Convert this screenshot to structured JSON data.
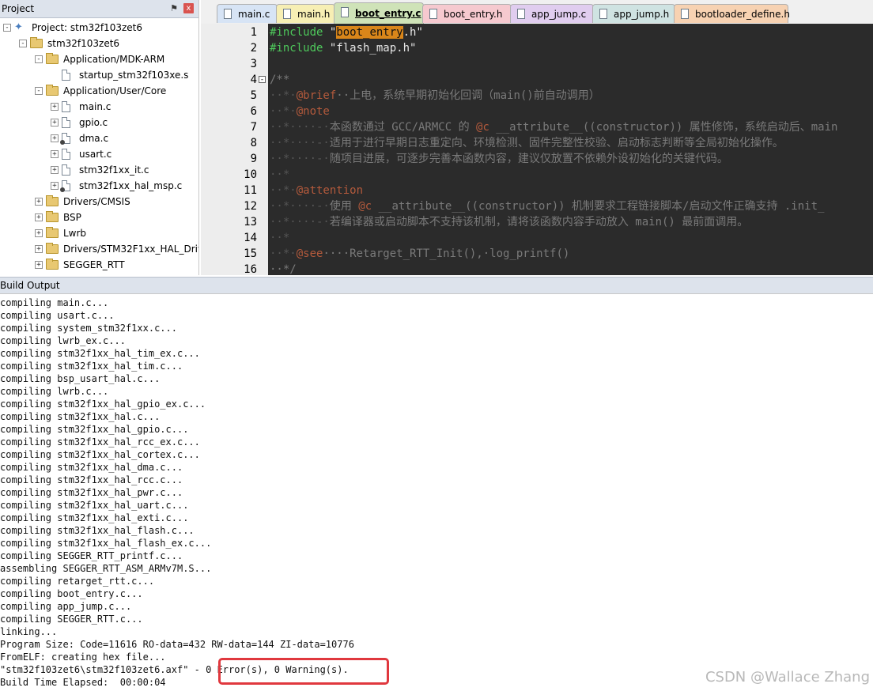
{
  "project": {
    "header_title": "Project",
    "pin_glyph": "⚑",
    "close_glyph": "x",
    "tree": [
      {
        "label": "Project: stm32f103zet6",
        "icon": "project-icon",
        "toggle": "-"
      },
      {
        "label": "stm32f103zet6",
        "icon": "target-folder-icon",
        "toggle": "-"
      },
      {
        "label": "Application/MDK-ARM",
        "icon": "folder-icon",
        "toggle": "-"
      },
      {
        "label": "startup_stm32f103xe.s",
        "icon": "file-icon",
        "toggle": ""
      },
      {
        "label": "Application/User/Core",
        "icon": "folder-icon",
        "toggle": "-"
      },
      {
        "label": "main.c",
        "icon": "file-icon",
        "toggle": "+"
      },
      {
        "label": "gpio.c",
        "icon": "file-icon",
        "toggle": "+"
      },
      {
        "label": "dma.c",
        "icon": "file-key-icon",
        "toggle": "+"
      },
      {
        "label": "usart.c",
        "icon": "file-icon",
        "toggle": "+"
      },
      {
        "label": "stm32f1xx_it.c",
        "icon": "file-icon",
        "toggle": "+"
      },
      {
        "label": "stm32f1xx_hal_msp.c",
        "icon": "file-key-icon",
        "toggle": "+"
      },
      {
        "label": "Drivers/CMSIS",
        "icon": "folder-icon",
        "toggle": "+"
      },
      {
        "label": "BSP",
        "icon": "folder-icon",
        "toggle": "+"
      },
      {
        "label": "Lwrb",
        "icon": "folder-icon",
        "toggle": "+"
      },
      {
        "label": "Drivers/STM32F1xx_HAL_Driver",
        "icon": "folder-icon",
        "toggle": "+"
      },
      {
        "label": "SEGGER_RTT",
        "icon": "folder-icon",
        "toggle": "+"
      }
    ]
  },
  "tabs": [
    {
      "label": "main.c",
      "color": "#d7e4f5",
      "active": false
    },
    {
      "label": "main.h",
      "color": "#f7efb4",
      "active": false
    },
    {
      "label": "boot_entry.c",
      "color": "#cfe3b8",
      "active": true
    },
    {
      "label": "boot_entry.h",
      "color": "#f6c9cf",
      "active": false
    },
    {
      "label": "app_jump.c",
      "color": "#e0cdef",
      "active": false
    },
    {
      "label": "app_jump.h",
      "color": "#cfe3e2",
      "active": false
    },
    {
      "label": "bootloader_define.h",
      "color": "#f7d2b2",
      "active": false
    }
  ],
  "editor": {
    "line_numbers": [
      "1",
      "2",
      "3",
      "4",
      "5",
      "6",
      "7",
      "8",
      "9",
      "10",
      "11",
      "12",
      "13",
      "14",
      "15",
      "16"
    ],
    "lines": [
      [
        {
          "t": "#include ",
          "c": "c-inc"
        },
        {
          "t": "\"",
          "c": "c-str"
        },
        {
          "t": "boot_entry",
          "c": "c-hl"
        },
        {
          "t": ".h\"",
          "c": "c-str"
        }
      ],
      [
        {
          "t": "#include ",
          "c": "c-inc"
        },
        {
          "t": "\"flash_map.h\"",
          "c": "c-str"
        }
      ],
      [],
      [
        {
          "t": "/**",
          "c": "c-cmt"
        }
      ],
      [
        {
          "t": "··*·",
          "c": "c-dot"
        },
        {
          "t": "@brief",
          "c": "c-tag"
        },
        {
          "t": "··上电，系统早期初始化回调（main()前自动调用）",
          "c": "c-cmt"
        }
      ],
      [
        {
          "t": "··*·",
          "c": "c-dot"
        },
        {
          "t": "@note",
          "c": "c-tag"
        }
      ],
      [
        {
          "t": "··*····-·",
          "c": "c-dot"
        },
        {
          "t": "本函数通过 GCC/ARMCC 的 ",
          "c": "c-cmt"
        },
        {
          "t": "@c",
          "c": "c-tag"
        },
        {
          "t": " __attribute__((constructor)) 属性修饰，系统启动后、main",
          "c": "c-cmt"
        }
      ],
      [
        {
          "t": "··*····-·",
          "c": "c-dot"
        },
        {
          "t": "适用于进行早期日志重定向、环境检测、固件完整性校验、启动标志判断等全局初始化操作。",
          "c": "c-cmt"
        }
      ],
      [
        {
          "t": "··*····-·",
          "c": "c-dot"
        },
        {
          "t": "随项目进展，可逐步完善本函数内容，建议仅放置不依赖外设初始化的关键代码。",
          "c": "c-cmt"
        }
      ],
      [
        {
          "t": "··*",
          "c": "c-dot"
        }
      ],
      [
        {
          "t": "··*·",
          "c": "c-dot"
        },
        {
          "t": "@attention",
          "c": "c-tag"
        }
      ],
      [
        {
          "t": "··*····-·",
          "c": "c-dot"
        },
        {
          "t": "使用 ",
          "c": "c-cmt"
        },
        {
          "t": "@c",
          "c": "c-tag"
        },
        {
          "t": " __attribute__((constructor)) 机制要求工程链接脚本/启动文件正确支持 .init_",
          "c": "c-cmt"
        }
      ],
      [
        {
          "t": "··*····-·",
          "c": "c-dot"
        },
        {
          "t": "若编译器或启动脚本不支持该机制，请将该函数内容手动放入 main() 最前面调用。",
          "c": "c-cmt"
        }
      ],
      [
        {
          "t": "··*",
          "c": "c-dot"
        }
      ],
      [
        {
          "t": "··*·",
          "c": "c-dot"
        },
        {
          "t": "@see",
          "c": "c-tag"
        },
        {
          "t": "····Retarget_RTT_Init(),·log_printf()",
          "c": "c-cmt"
        }
      ],
      [
        {
          "t": "··*/",
          "c": "c-cmt"
        }
      ]
    ]
  },
  "build": {
    "header_title": "Build Output",
    "lines": [
      "compiling main.c...",
      "compiling usart.c...",
      "compiling system_stm32f1xx.c...",
      "compiling lwrb_ex.c...",
      "compiling stm32f1xx_hal_tim_ex.c...",
      "compiling stm32f1xx_hal_tim.c...",
      "compiling bsp_usart_hal.c...",
      "compiling lwrb.c...",
      "compiling stm32f1xx_hal_gpio_ex.c...",
      "compiling stm32f1xx_hal.c...",
      "compiling stm32f1xx_hal_gpio.c...",
      "compiling stm32f1xx_hal_rcc_ex.c...",
      "compiling stm32f1xx_hal_cortex.c...",
      "compiling stm32f1xx_hal_dma.c...",
      "compiling stm32f1xx_hal_rcc.c...",
      "compiling stm32f1xx_hal_pwr.c...",
      "compiling stm32f1xx_hal_uart.c...",
      "compiling stm32f1xx_hal_exti.c...",
      "compiling stm32f1xx_hal_flash.c...",
      "compiling stm32f1xx_hal_flash_ex.c...",
      "compiling SEGGER_RTT_printf.c...",
      "assembling SEGGER_RTT_ASM_ARMv7M.S...",
      "compiling retarget_rtt.c...",
      "compiling boot_entry.c...",
      "compiling app_jump.c...",
      "compiling SEGGER_RTT.c...",
      "linking...",
      "Program Size: Code=11616 RO-data=432 RW-data=144 ZI-data=10776",
      "FromELF: creating hex file...",
      "\"stm32f103zet6\\stm32f103zet6.axf\" - 0 Error(s), 0 Warning(s).",
      "Build Time Elapsed:  00:00:04"
    ]
  },
  "watermark": "CSDN @Wallace Zhang"
}
